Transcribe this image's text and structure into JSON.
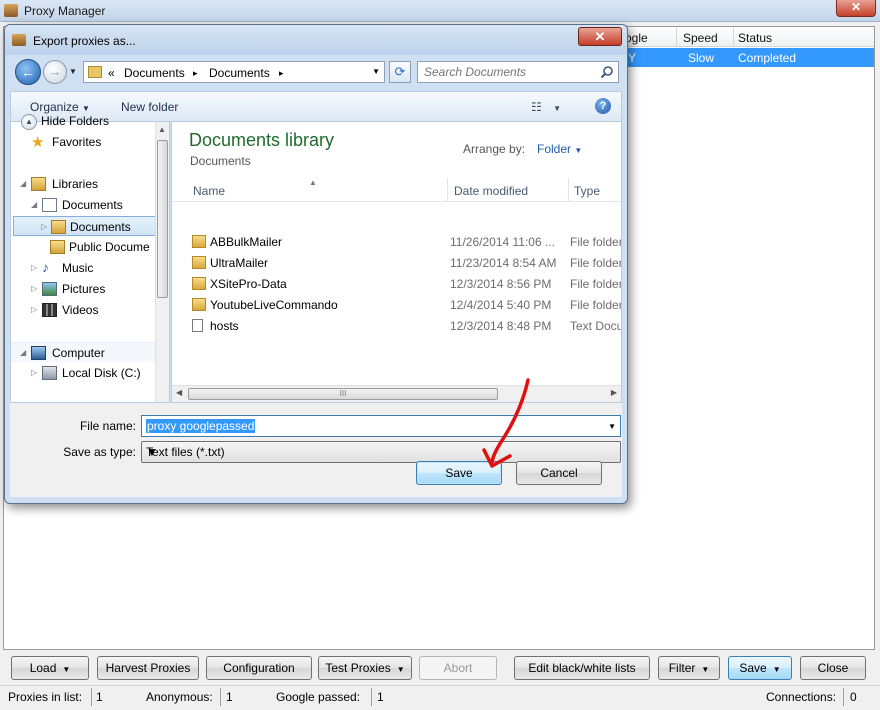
{
  "main": {
    "title": "Proxy Manager",
    "close_glyph": "✕",
    "grid": {
      "columns": [
        "ogle",
        "Speed",
        "Status"
      ],
      "row": {
        "google": "Y",
        "speed": "Slow",
        "status": "Completed"
      }
    },
    "toolbar": {
      "load": "Load",
      "harvest": "Harvest Proxies",
      "configuration": "Configuration",
      "test": "Test Proxies",
      "abort": "Abort",
      "edit_lists": "Edit black/white lists",
      "filter": "Filter",
      "save": "Save",
      "close": "Close"
    },
    "status_bar": {
      "proxies_label": "Proxies in list:",
      "proxies_value": "1",
      "anon_label": "Anonymous:",
      "anon_value": "1",
      "google_label": "Google passed:",
      "google_value": "1",
      "conn_label": "Connections:",
      "conn_value": "0"
    }
  },
  "dialog": {
    "title": "Export proxies as...",
    "close_glyph": "✕",
    "address": {
      "overflow": "«",
      "crumb1": "Documents",
      "crumb2": "Documents",
      "sep": "▸"
    },
    "search": {
      "placeholder": "Search Documents"
    },
    "commands": {
      "organize": "Organize",
      "new_folder": "New folder"
    },
    "nav_pane": {
      "favorites": "Favorites",
      "libraries": "Libraries",
      "documents": "Documents",
      "documents_sub": "Documents",
      "public_documents": "Public Docume",
      "music": "Music",
      "pictures": "Pictures",
      "videos": "Videos",
      "computer": "Computer",
      "local_disk": "Local Disk (C:)"
    },
    "library": {
      "title": "Documents library",
      "subtitle": "Documents",
      "arrange_label": "Arrange by:",
      "arrange_value": "Folder"
    },
    "columns": {
      "name": "Name",
      "date": "Date modified",
      "type": "Type"
    },
    "files": [
      {
        "name": "ABBulkMailer",
        "date": "11/26/2014 11:06 ...",
        "type": "File folder",
        "kind": "folder"
      },
      {
        "name": "UltraMailer",
        "date": "11/23/2014 8:54 AM",
        "type": "File folder",
        "kind": "folder"
      },
      {
        "name": "XSitePro-Data",
        "date": "12/3/2014 8:56 PM",
        "type": "File folder",
        "kind": "folder"
      },
      {
        "name": "YoutubeLiveCommando",
        "date": "12/4/2014 5:40 PM",
        "type": "File folder",
        "kind": "folder"
      },
      {
        "name": "hosts",
        "date": "12/3/2014 8:48 PM",
        "type": "Text Docu",
        "kind": "file"
      }
    ],
    "form": {
      "filename_label": "File name:",
      "filename_value": "proxy googlepassed",
      "type_label": "Save as type:",
      "type_value": "Text files (*.txt)",
      "hide_folders": "Hide Folders",
      "save": "Save",
      "cancel": "Cancel"
    }
  },
  "colors": {
    "selection": "#3399ff",
    "library_title": "#1e6b2d",
    "link_blue": "#1e5dab",
    "annotation_arrow": "#e01010"
  },
  "icons": [
    "app-icon",
    "close-icon",
    "back-arrow-icon",
    "forward-arrow-icon",
    "refresh-icon",
    "search-icon",
    "help-icon",
    "star-icon",
    "library-icon",
    "document-icon",
    "music-icon",
    "pictures-icon",
    "videos-icon",
    "computer-icon",
    "disk-icon",
    "folder-icon",
    "text-file-icon",
    "chevron-up-icon"
  ]
}
